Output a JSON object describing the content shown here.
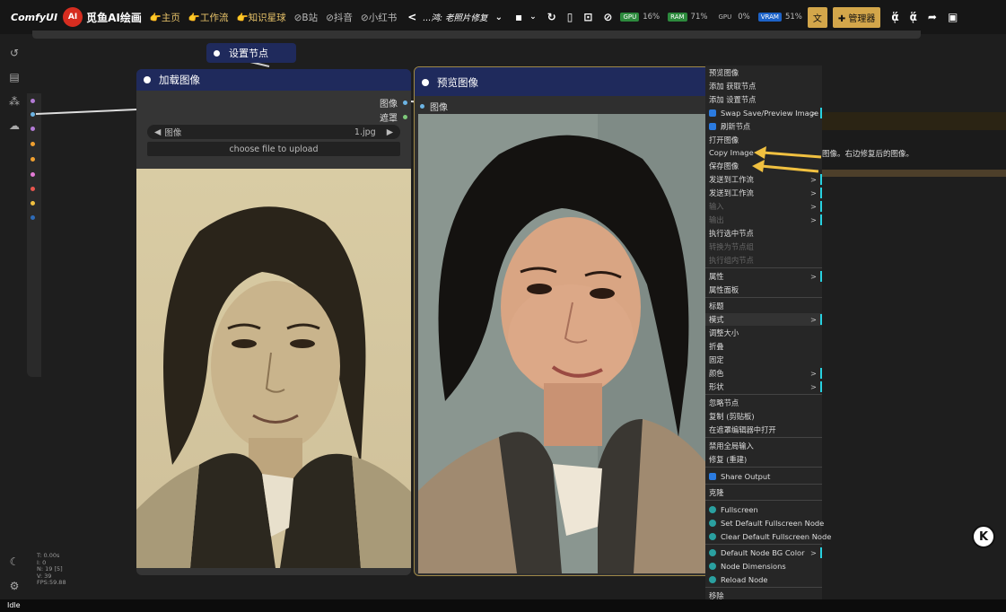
{
  "topbar": {
    "app_name": "ComfyUI",
    "brand_badge": "AI",
    "brand_name": "觅鱼AI绘画",
    "links": [
      "👉主页",
      "👉工作流",
      "👉知识星球",
      "⊘B站",
      "⊘抖音",
      "⊘小红书"
    ],
    "workflow_name": "...鸿: 老照片修复",
    "gpu_label": "GPU",
    "gpu_value": "16%",
    "ram_label": "RAM",
    "ram_value": "71%",
    "gpu2_label": "GPU",
    "gpu2_value": "0%",
    "vram_label": "VRAM",
    "vram_value": "51%",
    "translate_label": "文",
    "manager_label": "管理器"
  },
  "nodes": {
    "set_node": {
      "title": "设置节点"
    },
    "load_image": {
      "title": "加载图像",
      "outputs": [
        "图像",
        "遮罩"
      ],
      "image_widget_label": "图像",
      "image_widget_value": "1.jpg",
      "upload_label": "choose file to upload"
    },
    "preview_image": {
      "title": "预览图像",
      "input_label": "图像"
    },
    "bg_node_text": "图像。右边修复后的图像。"
  },
  "context_menu": {
    "items": [
      {
        "label": "预览图像"
      },
      {
        "label": "添加 获取节点"
      },
      {
        "label": "添加 设置节点"
      },
      {
        "label": "Swap Save/Preview Image",
        "submenu": true
      },
      {
        "label": "刷新节点"
      },
      {
        "label": "打开图像"
      },
      {
        "label": "Copy Image"
      },
      {
        "label": "保存图像"
      },
      {
        "label": "发送到工作流",
        "submenu": true
      },
      {
        "label": "发送到工作流",
        "submenu": true
      },
      {
        "label": "输入",
        "submenu": true,
        "disabled": true
      },
      {
        "label": "输出",
        "submenu": true,
        "disabled": true
      },
      {
        "label": "执行选中节点"
      },
      {
        "label": "转换为节点组",
        "disabled": true
      },
      {
        "label": "执行组内节点",
        "disabled": true
      },
      {
        "label": "属性",
        "submenu": true
      },
      {
        "label": "属性面板"
      },
      {
        "label": "标题"
      },
      {
        "label": "模式",
        "submenu": true
      },
      {
        "label": "调整大小"
      },
      {
        "label": "折叠"
      },
      {
        "label": "固定"
      },
      {
        "label": "颜色",
        "submenu": true
      },
      {
        "label": "形状",
        "submenu": true
      },
      {
        "label": "忽略节点"
      },
      {
        "label": "复制 (剪贴板)"
      },
      {
        "label": "在遮罩编辑器中打开"
      },
      {
        "label": "禁用全局输入"
      },
      {
        "label": "修复 (重建)"
      },
      {
        "label": "Share Output"
      },
      {
        "label": "克隆"
      },
      {
        "label": "Fullscreen"
      },
      {
        "label": "Set Default Fullscreen Node"
      },
      {
        "label": "Clear Default Fullscreen Node"
      },
      {
        "label": "Default Node BG Color",
        "submenu": true
      },
      {
        "label": "Node Dimensions"
      },
      {
        "label": "Reload Node"
      },
      {
        "label": "移除"
      }
    ]
  },
  "stats": {
    "lines": [
      "T: 0.00s",
      "I: 0",
      "N: 19 [5]",
      "V: 39",
      "FPS:59.88"
    ]
  },
  "status": "Idle",
  "k_badge": "K",
  "colors": {
    "node_header": "#1f2a5c",
    "selected_border": "#a08a48",
    "arrow": "#f0c040",
    "menu_edge": "#28d1e0"
  }
}
